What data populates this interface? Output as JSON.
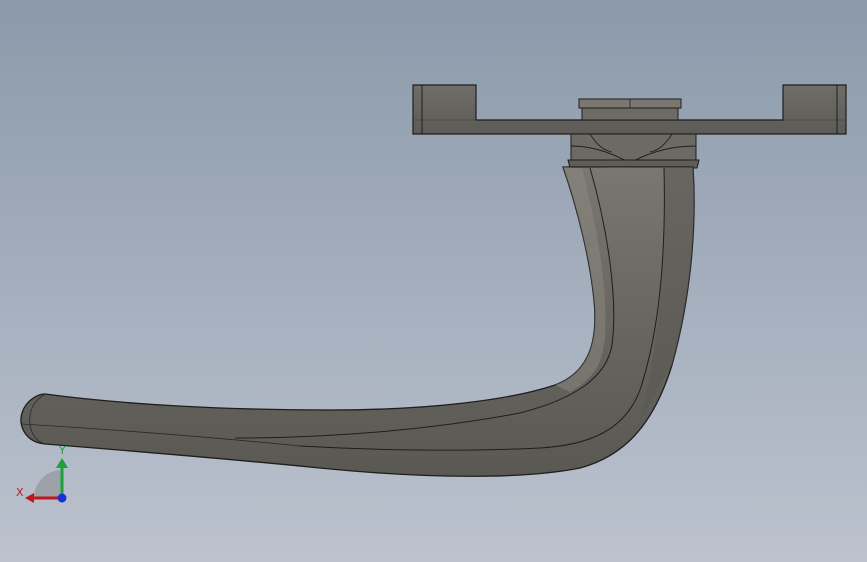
{
  "viewport": {
    "background_top": "#8b9aab",
    "background_bottom": "#bcc2ce"
  },
  "model": {
    "icon": "door-handle-3d-model",
    "body_color": "#6a6862",
    "body_highlight": "#8a8780",
    "body_shadow": "#4e4c48",
    "edge_color": "#1e1e1c"
  },
  "triad": {
    "x_label": "X",
    "y_label": "Y",
    "x_color": "#c0171d",
    "y_color": "#1aa23c",
    "z_color": "#1b2fd6"
  }
}
